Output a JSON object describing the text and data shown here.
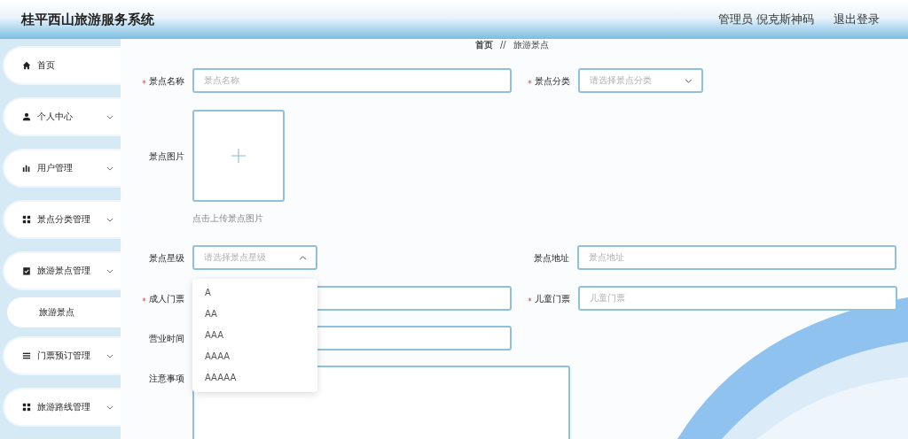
{
  "header": {
    "title": "桂平西山旅游服务系统",
    "user": "管理员 倪克斯神码",
    "logout": "退出登录"
  },
  "sidebar": {
    "items": [
      {
        "label": "首页",
        "has_arrow": false
      },
      {
        "label": "个人中心",
        "has_arrow": true
      },
      {
        "label": "用户管理",
        "has_arrow": true
      },
      {
        "label": "景点分类管理",
        "has_arrow": true
      },
      {
        "label": "旅游景点管理",
        "has_arrow": true,
        "children": [
          {
            "label": "旅游景点"
          }
        ]
      },
      {
        "label": "门票预订管理",
        "has_arrow": true
      },
      {
        "label": "旅游路线管理",
        "has_arrow": true
      }
    ]
  },
  "breadcrumb": [
    "首页",
    "//",
    "旅游景点"
  ],
  "form": {
    "rows": [
      [
        {
          "kind": "text",
          "label": "景点名称",
          "required": true,
          "placeholder": "景点名称"
        },
        {
          "kind": "select",
          "label": "景点分类",
          "required": true,
          "placeholder": "请选择景点分类",
          "expanded": false
        }
      ],
      [
        {
          "kind": "upload",
          "label": "景点图片",
          "required": false,
          "hint": "点击上传景点图片"
        }
      ],
      [
        {
          "kind": "select",
          "label": "景点星级",
          "required": false,
          "placeholder": "请选择景点星级",
          "expanded": true
        },
        {
          "kind": "text",
          "label": "景点地址",
          "required": false,
          "placeholder": "景点地址"
        }
      ],
      [
        {
          "kind": "text",
          "label": "成人门票",
          "required": true
        },
        {
          "kind": "text",
          "label": "儿童门票",
          "required": true,
          "placeholder": "儿童门票"
        }
      ],
      [
        {
          "kind": "text",
          "label": "营业时间",
          "required": false
        }
      ],
      [
        {
          "kind": "textarea",
          "label": "注意事项",
          "required": false
        }
      ]
    ]
  },
  "open_dropdown": {
    "options": [
      "A",
      "AA",
      "AAA",
      "AAAA",
      "AAAAA"
    ]
  }
}
